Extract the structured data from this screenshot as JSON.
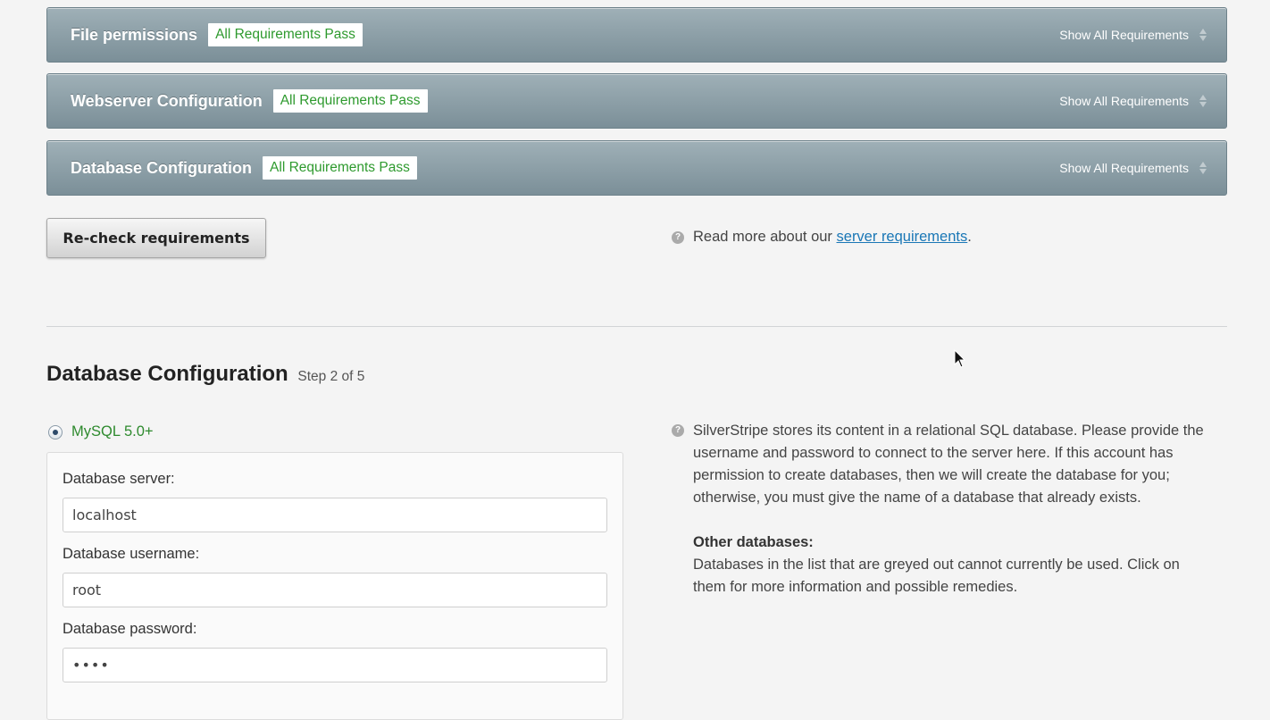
{
  "requirements": [
    {
      "title": "File permissions",
      "badge": "All Requirements Pass",
      "toggle": "Show All Requirements"
    },
    {
      "title": "Webserver Configuration",
      "badge": "All Requirements Pass",
      "toggle": "Show All Requirements"
    },
    {
      "title": "Database Configuration",
      "badge": "All Requirements Pass",
      "toggle": "Show All Requirements"
    }
  ],
  "recheck_button": "Re-check requirements",
  "info": {
    "prefix": "Read more about our ",
    "link": "server requirements",
    "suffix": "."
  },
  "db_section": {
    "title": "Database Configuration",
    "step": "Step 2 of 5",
    "selected_db": "MySQL 5.0+",
    "fields": {
      "server_label": "Database server:",
      "server_value": "localhost",
      "username_label": "Database username:",
      "username_value": "root",
      "password_label": "Database password:",
      "password_value": "••••"
    }
  },
  "help": {
    "paragraph": "SilverStripe stores its content in a relational SQL database. Please provide the username and password to connect to the server here. If this account has permission to create databases, then we will create the database for you; otherwise, you must give the name of a database that already exists.",
    "other_title": "Other databases:",
    "other_text": "Databases in the list that are greyed out cannot currently be used. Click on them for more information and possible remedies."
  },
  "colors": {
    "bar": "#8a9ca5",
    "pass": "#2e9a2e",
    "link": "#1a77b6"
  }
}
